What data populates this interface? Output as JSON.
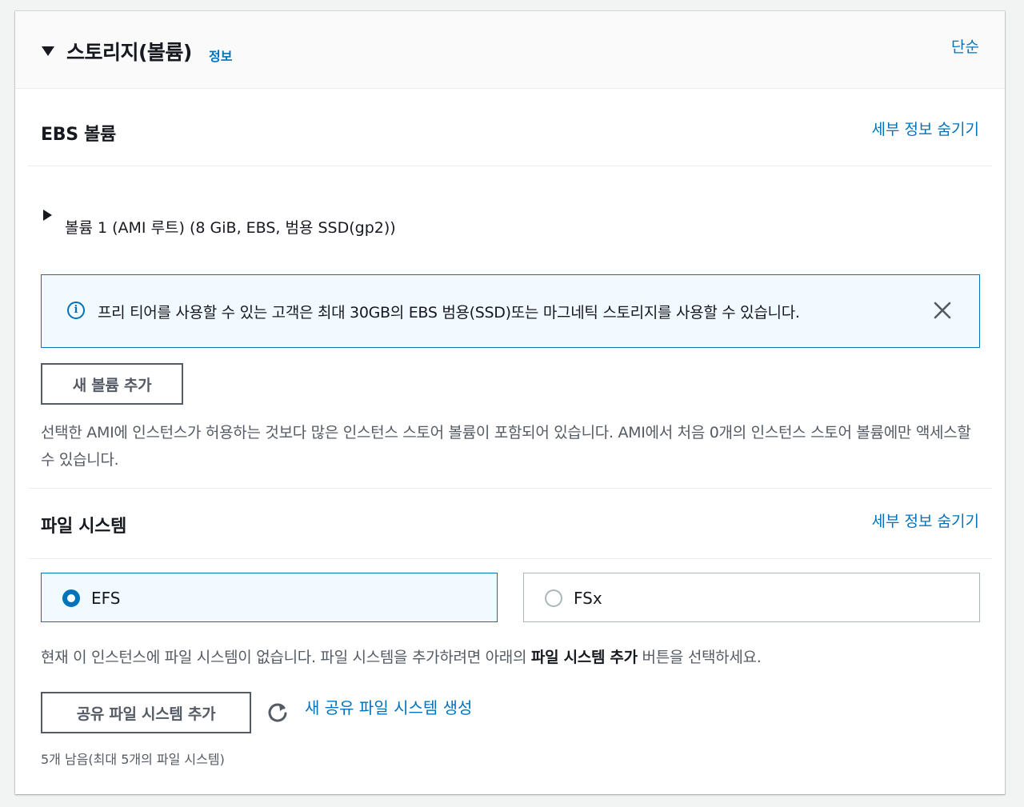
{
  "header": {
    "title": "스토리지(볼륨)",
    "info_link": "정보",
    "simple_link": "단순"
  },
  "ebs": {
    "title": "EBS 볼륨",
    "hide_details_link": "세부 정보 숨기기",
    "volume_item": "볼륨 1 (AMI 루트) (8 GiB, EBS, 범용 SSD(gp2))",
    "info_alert": "프리 티어를 사용할 수 있는 고객은 최대 30GB의 EBS 범용(SSD)또는 마그네틱 스토리지를 사용할 수 있습니다.",
    "add_volume_button": "새 볼륨 추가",
    "instance_store_note": "선택한 AMI에 인스턴스가 허용하는 것보다 많은 인스턴스 스토어 볼륨이 포함되어 있습니다. AMI에서 처음 0개의 인스턴스 스토어 볼륨에만 액세스할 수 있습니다."
  },
  "filesystem": {
    "title": "파일 시스템",
    "hide_details_link": "세부 정보 숨기기",
    "options": [
      {
        "label": "EFS",
        "selected": true
      },
      {
        "label": "FSx",
        "selected": false
      }
    ],
    "note_prefix": "현재 이 인스턴스에 파일 시스템이 없습니다. 파일 시스템을 추가하려면 아래의 ",
    "note_bold": "파일 시스템 추가",
    "note_suffix": " 버튼을 선택하세요.",
    "add_shared_button": "공유 파일 시스템 추가",
    "create_shared_link": "새 공유 파일 시스템 생성",
    "remaining": "5개 남음(최대 5개의 파일 시스템)"
  },
  "colors": {
    "link": "#0073bb",
    "info_bg": "#f1faff",
    "text": "#16191f",
    "secondary_text": "#545b64"
  },
  "icons": {
    "expand": "caret-down-icon",
    "collapsed": "caret-right-icon",
    "info": "info-circle-icon",
    "close": "close-icon",
    "refresh": "refresh-icon"
  }
}
